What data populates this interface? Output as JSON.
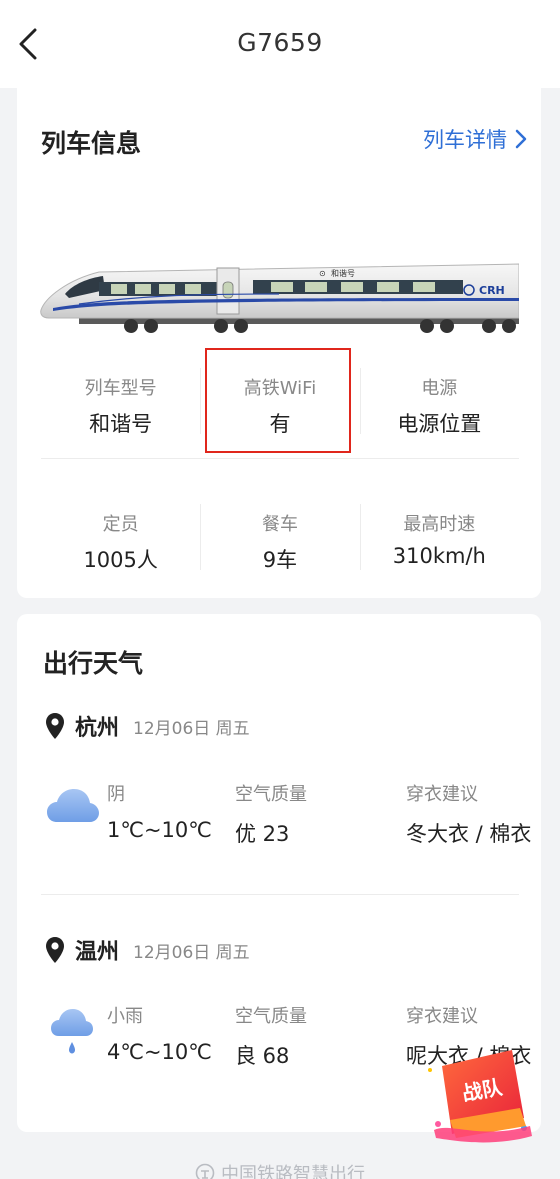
{
  "header": {
    "title": "G7659"
  },
  "train_info": {
    "title": "列车信息",
    "detail_link": "列车详情",
    "train_logo_text": "和谐号",
    "crh_text": "CRH",
    "rows": [
      [
        {
          "label": "列车型号",
          "value": "和谐号"
        },
        {
          "label": "高铁WiFi",
          "value": "有"
        },
        {
          "label": "电源",
          "value": "电源位置"
        }
      ],
      [
        {
          "label": "定员",
          "value": "1005人"
        },
        {
          "label": "餐车",
          "value": "9车"
        },
        {
          "label": "最高时速",
          "value": "310km/h"
        }
      ]
    ]
  },
  "weather": {
    "title": "出行天气",
    "cities": [
      {
        "name": "杭州",
        "date": "12月06日 周五",
        "condition": "阴",
        "temp": "1℃~10℃",
        "air_label": "空气质量",
        "air_value": "优 23",
        "dress_label": "穿衣建议",
        "dress_value": "冬大衣 / 棉衣",
        "icon": "cloudy-icon"
      },
      {
        "name": "温州",
        "date": "12月06日 周五",
        "condition": "小雨",
        "temp": "4℃~10℃",
        "air_label": "空气质量",
        "air_value": "良 68",
        "dress_label": "穿衣建议",
        "dress_value": "呢大衣 / 棉衣",
        "icon": "light-rain-icon"
      }
    ]
  },
  "badge": {
    "text": "战队"
  },
  "footer": {
    "text": "中国铁路智慧出行"
  },
  "colors": {
    "accent": "#2f6fd6",
    "highlight": "#e0261c"
  }
}
